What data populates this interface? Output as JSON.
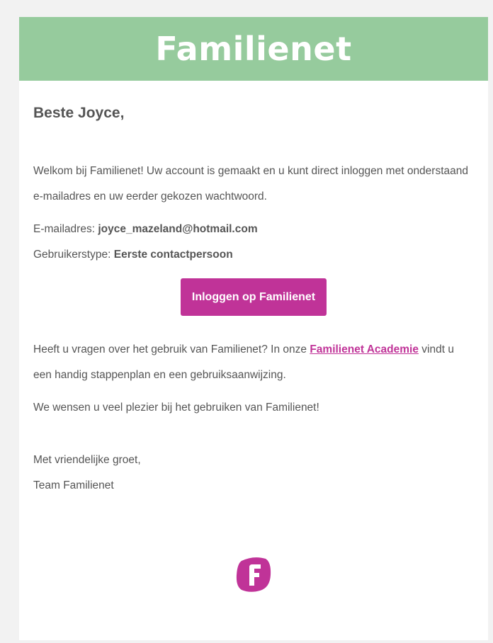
{
  "header": {
    "brand": "Familienet",
    "bg_color": "#96cb9d"
  },
  "email": {
    "greeting": "Beste Joyce,",
    "intro": "Welkom bij Familienet! Uw account is gemaakt en u kunt direct inloggen met onderstaand e-mailadres en uw eerder gekozen wachtwoord.",
    "email_label": "E-mailadres:",
    "email_value": "joyce_mazeland@hotmail.com",
    "usertype_label": "Gebruikerstype:",
    "usertype_value": "Eerste contactpersoon",
    "login_button": "Inloggen op Familienet",
    "questions_text": "Heeft u vragen over het gebruik van Familienet? In onze",
    "academy_link": "Familienet Academie",
    "questions_text_2": "vindt u een handig stappenplan en een gebruiksaanwijzing.",
    "wishes": "We wensen u veel plezier bij het gebruiken van Familienet!",
    "closing": "Met vriendelijke groet,",
    "signature": "Team Familienet"
  },
  "colors": {
    "accent": "#c03398",
    "text": "#555555"
  },
  "footer": {
    "logo_icon": "familienet-f-logo-icon"
  }
}
